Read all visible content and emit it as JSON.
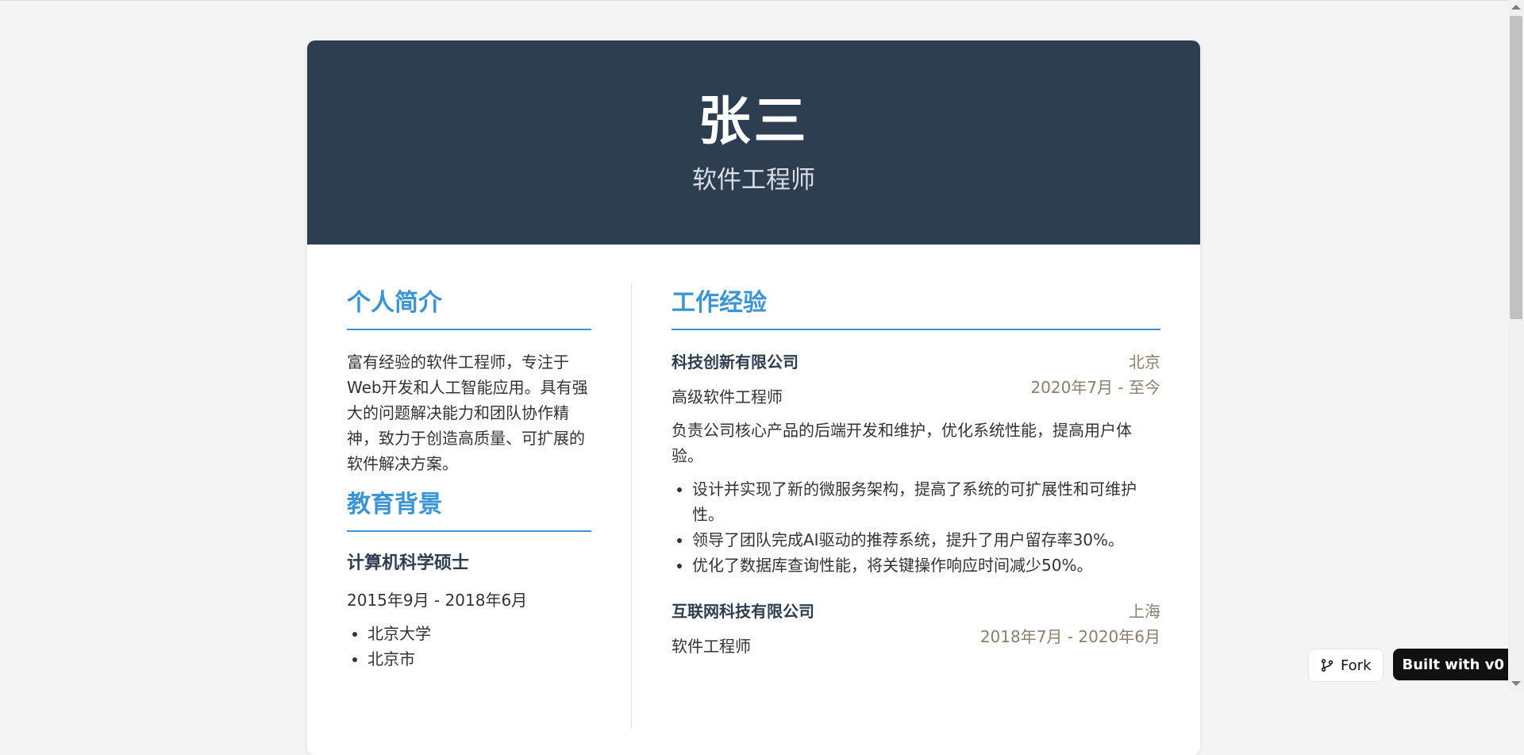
{
  "header": {
    "name": "张三",
    "role": "软件工程师"
  },
  "summary": {
    "title": "个人简介",
    "text": "富有经验的软件工程师，专注于Web开发和人工智能应用。具有强大的问题解决能力和团队协作精神，致力于创造高质量、可扩展的软件解决方案。"
  },
  "education": {
    "title": "教育背景",
    "degree": "计算机科学硕士",
    "date": "2015年9月 - 2018年6月",
    "details": [
      "北京大学",
      "北京市"
    ]
  },
  "experience": {
    "title": "工作经验",
    "jobs": [
      {
        "company": "科技创新有限公司",
        "location": "北京",
        "title": "高级软件工程师",
        "date": "2020年7月 - 至今",
        "description": "负责公司核心产品的后端开发和维护，优化系统性能，提高用户体验。",
        "highlights": [
          "设计并实现了新的微服务架构，提高了系统的可扩展性和可维护性。",
          "领导了团队完成AI驱动的推荐系统，提升了用户留存率30%。",
          "优化了数据库查询性能，将关键操作响应时间减少50%。"
        ]
      },
      {
        "company": "互联网科技有限公司",
        "location": "上海",
        "title": "软件工程师",
        "date": "2018年7月 - 2020年6月"
      }
    ]
  },
  "badges": {
    "fork_label": "Fork",
    "v0_label": "Built with v0"
  },
  "colors": {
    "header_bg": "#2d3e50",
    "accent": "#3a95d6",
    "meta": "#8c7f6a"
  }
}
